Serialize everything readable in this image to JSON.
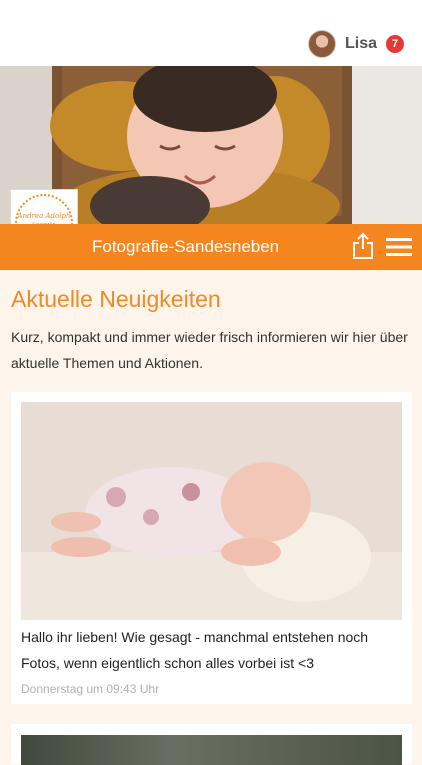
{
  "header": {
    "user_name": "Lisa",
    "notification_count": "7",
    "avatar_icon": "user-avatar"
  },
  "hero": {
    "image": "newborn-smiling-in-wooden-crate"
  },
  "logo": {
    "line1": "Andrea Adolph",
    "line2": "Fotografie"
  },
  "brand_bar": {
    "title": "Fotografie-Sandesneben",
    "share_icon": "share-icon",
    "menu_icon": "hamburger-menu-icon",
    "color": "#f5861f"
  },
  "main": {
    "heading": "Aktuelle Neuigkeiten",
    "intro": "Kurz, kompakt und immer wieder frisch informieren wir hier über aktuelle Themen und Aktionen."
  },
  "posts": [
    {
      "image": "sleeping-newborn-on-pillow",
      "text": "Hallo ihr lieben! Wie gesagt - manchmal entstehen noch Fotos, wenn eigentlich schon alles vorbei ist <3",
      "date": "Donnerstag um 09:43 Uhr"
    },
    {
      "image": "newborn-photo-second-post"
    }
  ],
  "colors": {
    "accent": "#f08a24",
    "background": "#fdf4ec",
    "badge": "#e53935"
  }
}
